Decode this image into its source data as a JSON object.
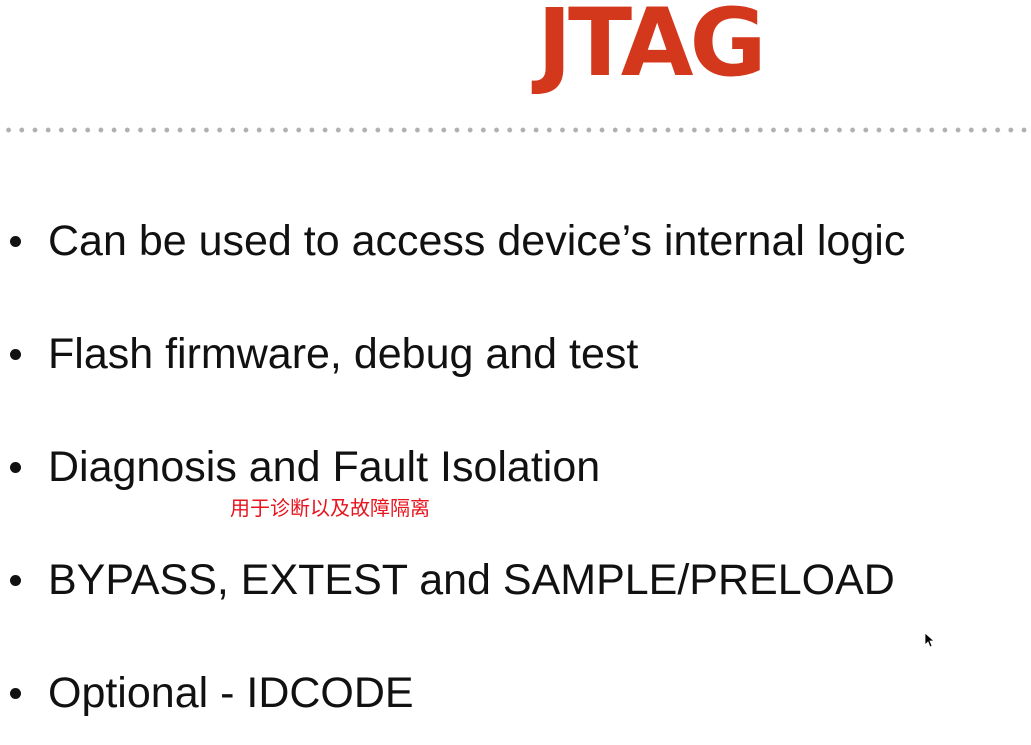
{
  "slide": {
    "title": "JTAG",
    "bullets": [
      "Can be used to access device’s internal logic",
      "Flash firmware, debug and test",
      "Diagnosis and Fault Isolation",
      "BYPASS, EXTEST and SAMPLE/PRELOAD",
      "Optional - IDCODE"
    ],
    "annotation": "用于诊断以及故障隔离"
  },
  "colors": {
    "title": "#d4381c",
    "body_text": "#111111",
    "annotation": "#e8141e",
    "divider_dots": "#b0b0b0",
    "background": "#ffffff"
  },
  "icons": {
    "cursor": "mouse-pointer-icon"
  }
}
